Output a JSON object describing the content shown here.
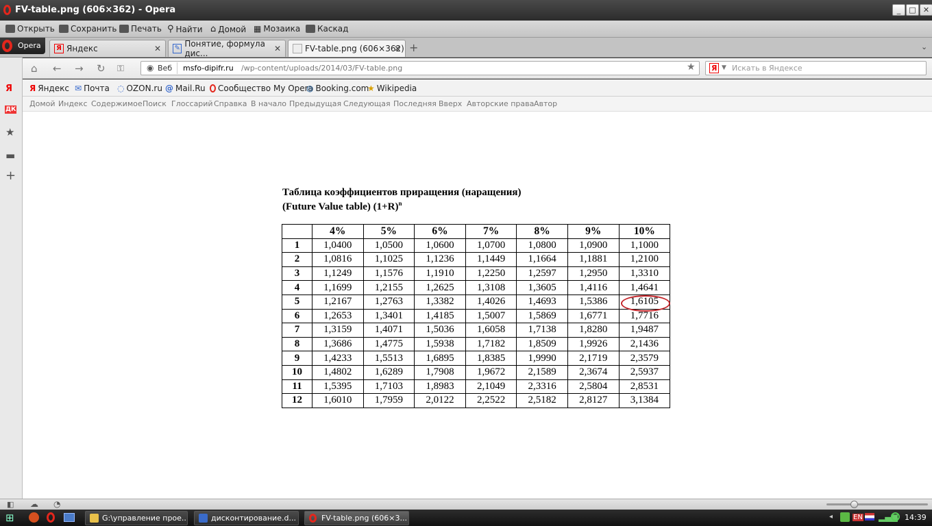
{
  "window": {
    "title": "FV-table.png (606×362) - Opera"
  },
  "menu": [
    "Открыть",
    "Сохранить",
    "Печать",
    "Найти",
    "Домой",
    "Мозаика",
    "Каскад"
  ],
  "opera_button": "Opera",
  "tabs": [
    {
      "label": "Яндекс",
      "favicon": "Я"
    },
    {
      "label": "Понятие, формула дис...",
      "favicon": "✎"
    },
    {
      "label": "FV-table.png (606×362)",
      "favicon": ""
    }
  ],
  "address": {
    "scope": "Веб",
    "url_domain": "msfo-dipifr.ru",
    "url_path": "/wp-content/uploads/2014/03/FV-table.png",
    "search_placeholder": "Искать в Яндексе",
    "search_engine": "Я"
  },
  "bookmarks": [
    "Яндекс",
    "Почта",
    "OZON.ru",
    "Mail.Ru",
    "Сообщество My Opera",
    "Booking.com",
    "Wikipedia"
  ],
  "site_nav": [
    "Домой",
    "Индекс",
    "Содержимое",
    "Поиск",
    "Глоссарий",
    "Справка",
    "В начало",
    "Предыдущая",
    "Следующая",
    "Последняя",
    "Вверх",
    "Авторские права",
    "Автор"
  ],
  "image": {
    "title_line1": "Таблица коэффициентов  приращения (наращения)",
    "title_line2": "(Future Value table)    (1+R)",
    "title_sup": "n",
    "headers": [
      "",
      "4%",
      "5%",
      "6%",
      "7%",
      "8%",
      "9%",
      "10%"
    ],
    "rows": [
      {
        "n": "1",
        "values": [
          "1,0400",
          "1,0500",
          "1,0600",
          "1,0700",
          "1,0800",
          "1,0900",
          "1,1000"
        ]
      },
      {
        "n": "2",
        "values": [
          "1,0816",
          "1,1025",
          "1,1236",
          "1,1449",
          "1,1664",
          "1,1881",
          "1,2100"
        ]
      },
      {
        "n": "3",
        "values": [
          "1,1249",
          "1,1576",
          "1,1910",
          "1,2250",
          "1,2597",
          "1,2950",
          "1,3310"
        ]
      },
      {
        "n": "4",
        "values": [
          "1,1699",
          "1,2155",
          "1,2625",
          "1,3108",
          "1,3605",
          "1,4116",
          "1,4641"
        ]
      },
      {
        "n": "5",
        "values": [
          "1,2167",
          "1,2763",
          "1,3382",
          "1,4026",
          "1,4693",
          "1,5386",
          "1,6105"
        ]
      },
      {
        "n": "6",
        "values": [
          "1,2653",
          "1,3401",
          "1,4185",
          "1,5007",
          "1,5869",
          "1,6771",
          "1,7716"
        ]
      },
      {
        "n": "7",
        "values": [
          "1,3159",
          "1,4071",
          "1,5036",
          "1,6058",
          "1,7138",
          "1,8280",
          "1,9487"
        ]
      },
      {
        "n": "8",
        "values": [
          "1,3686",
          "1,4775",
          "1,5938",
          "1,7182",
          "1,8509",
          "1,9926",
          "2,1436"
        ]
      },
      {
        "n": "9",
        "values": [
          "1,4233",
          "1,5513",
          "1,6895",
          "1,8385",
          "1,9990",
          "2,1719",
          "2,3579"
        ]
      },
      {
        "n": "10",
        "values": [
          "1,4802",
          "1,6289",
          "1,7908",
          "1,9672",
          "2,1589",
          "2,3674",
          "2,5937"
        ]
      },
      {
        "n": "11",
        "values": [
          "1,5395",
          "1,7103",
          "1,8983",
          "2,1049",
          "2,3316",
          "2,5804",
          "2,8531"
        ]
      },
      {
        "n": "12",
        "values": [
          "1,6010",
          "1,7959",
          "2,0122",
          "2,2522",
          "2,5182",
          "2,8127",
          "3,1384"
        ]
      }
    ],
    "highlight_color": "#c4262b"
  },
  "taskbar": {
    "items": [
      "G:\\управление прое...",
      "дисконтирование.d...",
      "FV-table.png (606×3..."
    ],
    "clock": "14:39"
  }
}
